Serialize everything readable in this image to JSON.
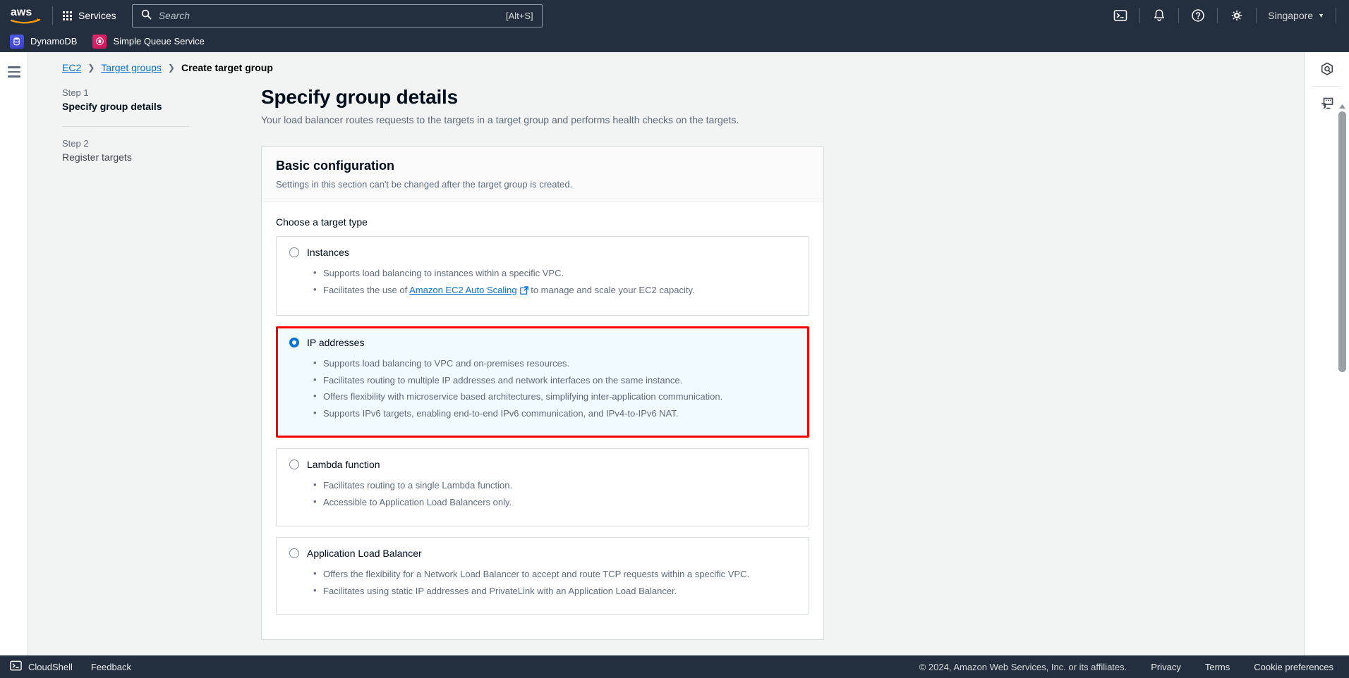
{
  "topnav": {
    "logo_alt": "aws",
    "services_label": "Services",
    "search": {
      "placeholder": "Search",
      "value": "",
      "shortcut": "[Alt+S]",
      "icon": "search-icon"
    },
    "icons": [
      {
        "name": "cloudshell-icon",
        "title": "CloudShell"
      },
      {
        "name": "notifications-bell-icon",
        "title": "Notifications"
      },
      {
        "name": "help-question-icon",
        "title": "Help"
      },
      {
        "name": "settings-gear-icon",
        "title": "Settings"
      }
    ],
    "region": {
      "label": "Singapore",
      "caret": "▼"
    }
  },
  "service_bar": {
    "items": [
      {
        "label": "DynamoDB",
        "icon": "dynamodb-icon",
        "color": "#4d5ce8"
      },
      {
        "label": "Simple Queue Service",
        "icon": "sqs-icon",
        "color": "#e3276b"
      }
    ]
  },
  "left_rail": {
    "menu_icon": "hamburger-menu-icon"
  },
  "breadcrumb": {
    "items": [
      {
        "label": "EC2",
        "link": true
      },
      {
        "label": "Target groups",
        "link": true
      },
      {
        "label": "Create target group",
        "link": false
      }
    ],
    "separator": "❯"
  },
  "wizard": {
    "steps": [
      {
        "number": "Step 1",
        "title": "Specify group details",
        "active": true
      },
      {
        "number": "Step 2",
        "title": "Register targets",
        "active": false
      }
    ]
  },
  "main": {
    "title": "Specify group details",
    "subtitle": "Your load balancer routes requests to the targets in a target group and performs health checks on the targets.",
    "card": {
      "heading": "Basic configuration",
      "description": "Settings in this section can't be changed after the target group is created.",
      "field_label": "Choose a target type",
      "selected_value": "ip-addresses",
      "highlight_color": "#ff0000",
      "selected_bg": "#f1faff",
      "accent_color": "#0972d3",
      "options": [
        {
          "id": "instances",
          "label": "Instances",
          "selected": false,
          "bullets": [
            {
              "text": "Supports load balancing to instances within a specific VPC."
            },
            {
              "text_before": "Facilitates the use of ",
              "link": "Amazon EC2 Auto Scaling",
              "link_icon": "external-link-icon",
              "text_after": " to manage and scale your EC2 capacity."
            }
          ]
        },
        {
          "id": "ip-addresses",
          "label": "IP addresses",
          "selected": true,
          "bullets": [
            {
              "text": "Supports load balancing to VPC and on-premises resources."
            },
            {
              "text": "Facilitates routing to multiple IP addresses and network interfaces on the same instance."
            },
            {
              "text": "Offers flexibility with microservice based architectures, simplifying inter-application communication."
            },
            {
              "text": "Supports IPv6 targets, enabling end-to-end IPv6 communication, and IPv4-to-IPv6 NAT."
            }
          ]
        },
        {
          "id": "lambda-function",
          "label": "Lambda function",
          "selected": false,
          "bullets": [
            {
              "text": "Facilitates routing to a single Lambda function."
            },
            {
              "text": "Accessible to Application Load Balancers only."
            }
          ]
        },
        {
          "id": "application-load-balancer",
          "label": "Application Load Balancer",
          "selected": false,
          "bullets": [
            {
              "text": "Offers the flexibility for a Network Load Balancer to accept and route TCP requests within a specific VPC."
            },
            {
              "text": "Facilitates using static IP addresses and PrivateLink with an Application Load Balancer."
            }
          ]
        }
      ]
    }
  },
  "right_rail": {
    "icons": [
      {
        "name": "aws-q-assistant-icon",
        "title": "Amazon Q"
      },
      {
        "name": "cli-shell-icon",
        "title": "CLI"
      }
    ]
  },
  "footer": {
    "cloudshell_label": "CloudShell",
    "feedback_label": "Feedback",
    "copyright": "© 2024, Amazon Web Services, Inc. or its affiliates.",
    "links": [
      "Privacy",
      "Terms",
      "Cookie preferences"
    ]
  }
}
